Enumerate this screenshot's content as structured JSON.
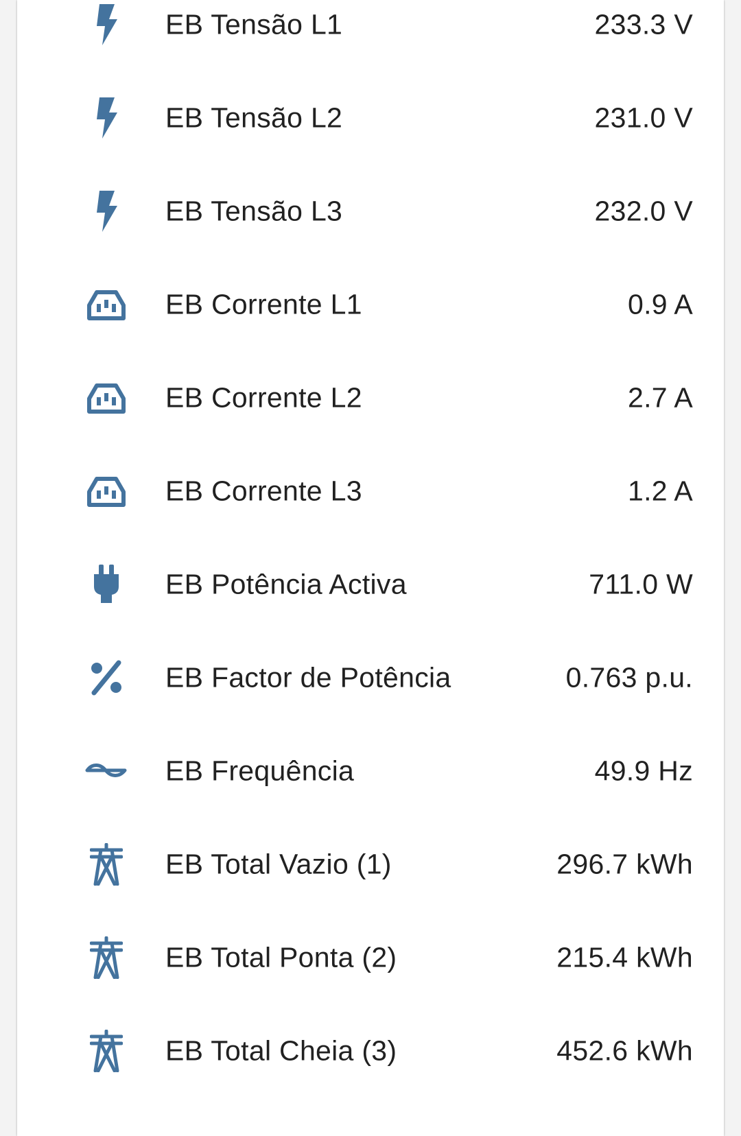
{
  "theme": {
    "icon_color": "#44739e",
    "text_color": "#212121",
    "card_background": "#ffffff"
  },
  "entities": [
    {
      "icon": "flash-icon",
      "name": "EB Tensão L1",
      "state": "233.3 V"
    },
    {
      "icon": "flash-icon",
      "name": "EB Tensão L2",
      "state": "231.0 V"
    },
    {
      "icon": "flash-icon",
      "name": "EB Tensão L3",
      "state": "232.0 V"
    },
    {
      "icon": "current-ac-socket-icon",
      "name": "EB Corrente L1",
      "state": "0.9 A"
    },
    {
      "icon": "current-ac-socket-icon",
      "name": "EB Corrente L2",
      "state": "2.7 A"
    },
    {
      "icon": "current-ac-socket-icon",
      "name": "EB Corrente L3",
      "state": "1.2 A"
    },
    {
      "icon": "power-plug-icon",
      "name": "EB Potência Activa",
      "state": "711.0 W"
    },
    {
      "icon": "percent-icon",
      "name": "EB Factor de Potência",
      "state": "0.763 p.u."
    },
    {
      "icon": "sine-wave-icon",
      "name": "EB Frequência",
      "state": "49.9 Hz"
    },
    {
      "icon": "transmission-tower-icon",
      "name": "EB Total Vazio (1)",
      "state": "296.7 kWh"
    },
    {
      "icon": "transmission-tower-icon",
      "name": "EB Total Ponta (2)",
      "state": "215.4 kWh"
    },
    {
      "icon": "transmission-tower-icon",
      "name": "EB Total Cheia (3)",
      "state": "452.6 kWh"
    }
  ]
}
